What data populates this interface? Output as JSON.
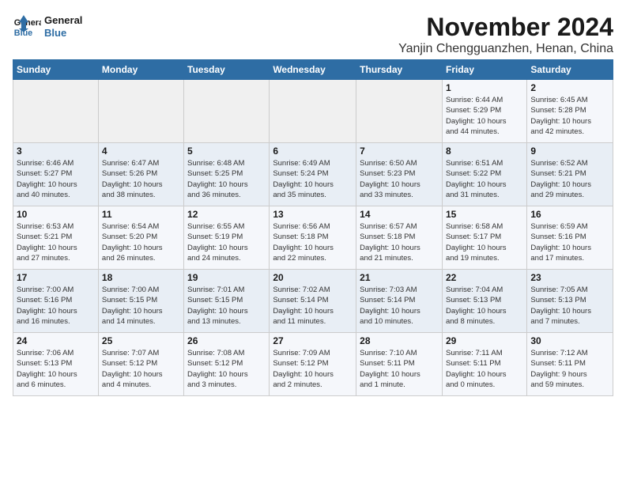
{
  "header": {
    "logo_line1": "General",
    "logo_line2": "Blue",
    "month_title": "November 2024",
    "location": "Yanjin Chengguanzhen, Henan, China"
  },
  "weekdays": [
    "Sunday",
    "Monday",
    "Tuesday",
    "Wednesday",
    "Thursday",
    "Friday",
    "Saturday"
  ],
  "weeks": [
    [
      {
        "day": "",
        "info": ""
      },
      {
        "day": "",
        "info": ""
      },
      {
        "day": "",
        "info": ""
      },
      {
        "day": "",
        "info": ""
      },
      {
        "day": "",
        "info": ""
      },
      {
        "day": "1",
        "info": "Sunrise: 6:44 AM\nSunset: 5:29 PM\nDaylight: 10 hours\nand 44 minutes."
      },
      {
        "day": "2",
        "info": "Sunrise: 6:45 AM\nSunset: 5:28 PM\nDaylight: 10 hours\nand 42 minutes."
      }
    ],
    [
      {
        "day": "3",
        "info": "Sunrise: 6:46 AM\nSunset: 5:27 PM\nDaylight: 10 hours\nand 40 minutes."
      },
      {
        "day": "4",
        "info": "Sunrise: 6:47 AM\nSunset: 5:26 PM\nDaylight: 10 hours\nand 38 minutes."
      },
      {
        "day": "5",
        "info": "Sunrise: 6:48 AM\nSunset: 5:25 PM\nDaylight: 10 hours\nand 36 minutes."
      },
      {
        "day": "6",
        "info": "Sunrise: 6:49 AM\nSunset: 5:24 PM\nDaylight: 10 hours\nand 35 minutes."
      },
      {
        "day": "7",
        "info": "Sunrise: 6:50 AM\nSunset: 5:23 PM\nDaylight: 10 hours\nand 33 minutes."
      },
      {
        "day": "8",
        "info": "Sunrise: 6:51 AM\nSunset: 5:22 PM\nDaylight: 10 hours\nand 31 minutes."
      },
      {
        "day": "9",
        "info": "Sunrise: 6:52 AM\nSunset: 5:21 PM\nDaylight: 10 hours\nand 29 minutes."
      }
    ],
    [
      {
        "day": "10",
        "info": "Sunrise: 6:53 AM\nSunset: 5:21 PM\nDaylight: 10 hours\nand 27 minutes."
      },
      {
        "day": "11",
        "info": "Sunrise: 6:54 AM\nSunset: 5:20 PM\nDaylight: 10 hours\nand 26 minutes."
      },
      {
        "day": "12",
        "info": "Sunrise: 6:55 AM\nSunset: 5:19 PM\nDaylight: 10 hours\nand 24 minutes."
      },
      {
        "day": "13",
        "info": "Sunrise: 6:56 AM\nSunset: 5:18 PM\nDaylight: 10 hours\nand 22 minutes."
      },
      {
        "day": "14",
        "info": "Sunrise: 6:57 AM\nSunset: 5:18 PM\nDaylight: 10 hours\nand 21 minutes."
      },
      {
        "day": "15",
        "info": "Sunrise: 6:58 AM\nSunset: 5:17 PM\nDaylight: 10 hours\nand 19 minutes."
      },
      {
        "day": "16",
        "info": "Sunrise: 6:59 AM\nSunset: 5:16 PM\nDaylight: 10 hours\nand 17 minutes."
      }
    ],
    [
      {
        "day": "17",
        "info": "Sunrise: 7:00 AM\nSunset: 5:16 PM\nDaylight: 10 hours\nand 16 minutes."
      },
      {
        "day": "18",
        "info": "Sunrise: 7:00 AM\nSunset: 5:15 PM\nDaylight: 10 hours\nand 14 minutes."
      },
      {
        "day": "19",
        "info": "Sunrise: 7:01 AM\nSunset: 5:15 PM\nDaylight: 10 hours\nand 13 minutes."
      },
      {
        "day": "20",
        "info": "Sunrise: 7:02 AM\nSunset: 5:14 PM\nDaylight: 10 hours\nand 11 minutes."
      },
      {
        "day": "21",
        "info": "Sunrise: 7:03 AM\nSunset: 5:14 PM\nDaylight: 10 hours\nand 10 minutes."
      },
      {
        "day": "22",
        "info": "Sunrise: 7:04 AM\nSunset: 5:13 PM\nDaylight: 10 hours\nand 8 minutes."
      },
      {
        "day": "23",
        "info": "Sunrise: 7:05 AM\nSunset: 5:13 PM\nDaylight: 10 hours\nand 7 minutes."
      }
    ],
    [
      {
        "day": "24",
        "info": "Sunrise: 7:06 AM\nSunset: 5:13 PM\nDaylight: 10 hours\nand 6 minutes."
      },
      {
        "day": "25",
        "info": "Sunrise: 7:07 AM\nSunset: 5:12 PM\nDaylight: 10 hours\nand 4 minutes."
      },
      {
        "day": "26",
        "info": "Sunrise: 7:08 AM\nSunset: 5:12 PM\nDaylight: 10 hours\nand 3 minutes."
      },
      {
        "day": "27",
        "info": "Sunrise: 7:09 AM\nSunset: 5:12 PM\nDaylight: 10 hours\nand 2 minutes."
      },
      {
        "day": "28",
        "info": "Sunrise: 7:10 AM\nSunset: 5:11 PM\nDaylight: 10 hours\nand 1 minute."
      },
      {
        "day": "29",
        "info": "Sunrise: 7:11 AM\nSunset: 5:11 PM\nDaylight: 10 hours\nand 0 minutes."
      },
      {
        "day": "30",
        "info": "Sunrise: 7:12 AM\nSunset: 5:11 PM\nDaylight: 9 hours\nand 59 minutes."
      }
    ]
  ]
}
